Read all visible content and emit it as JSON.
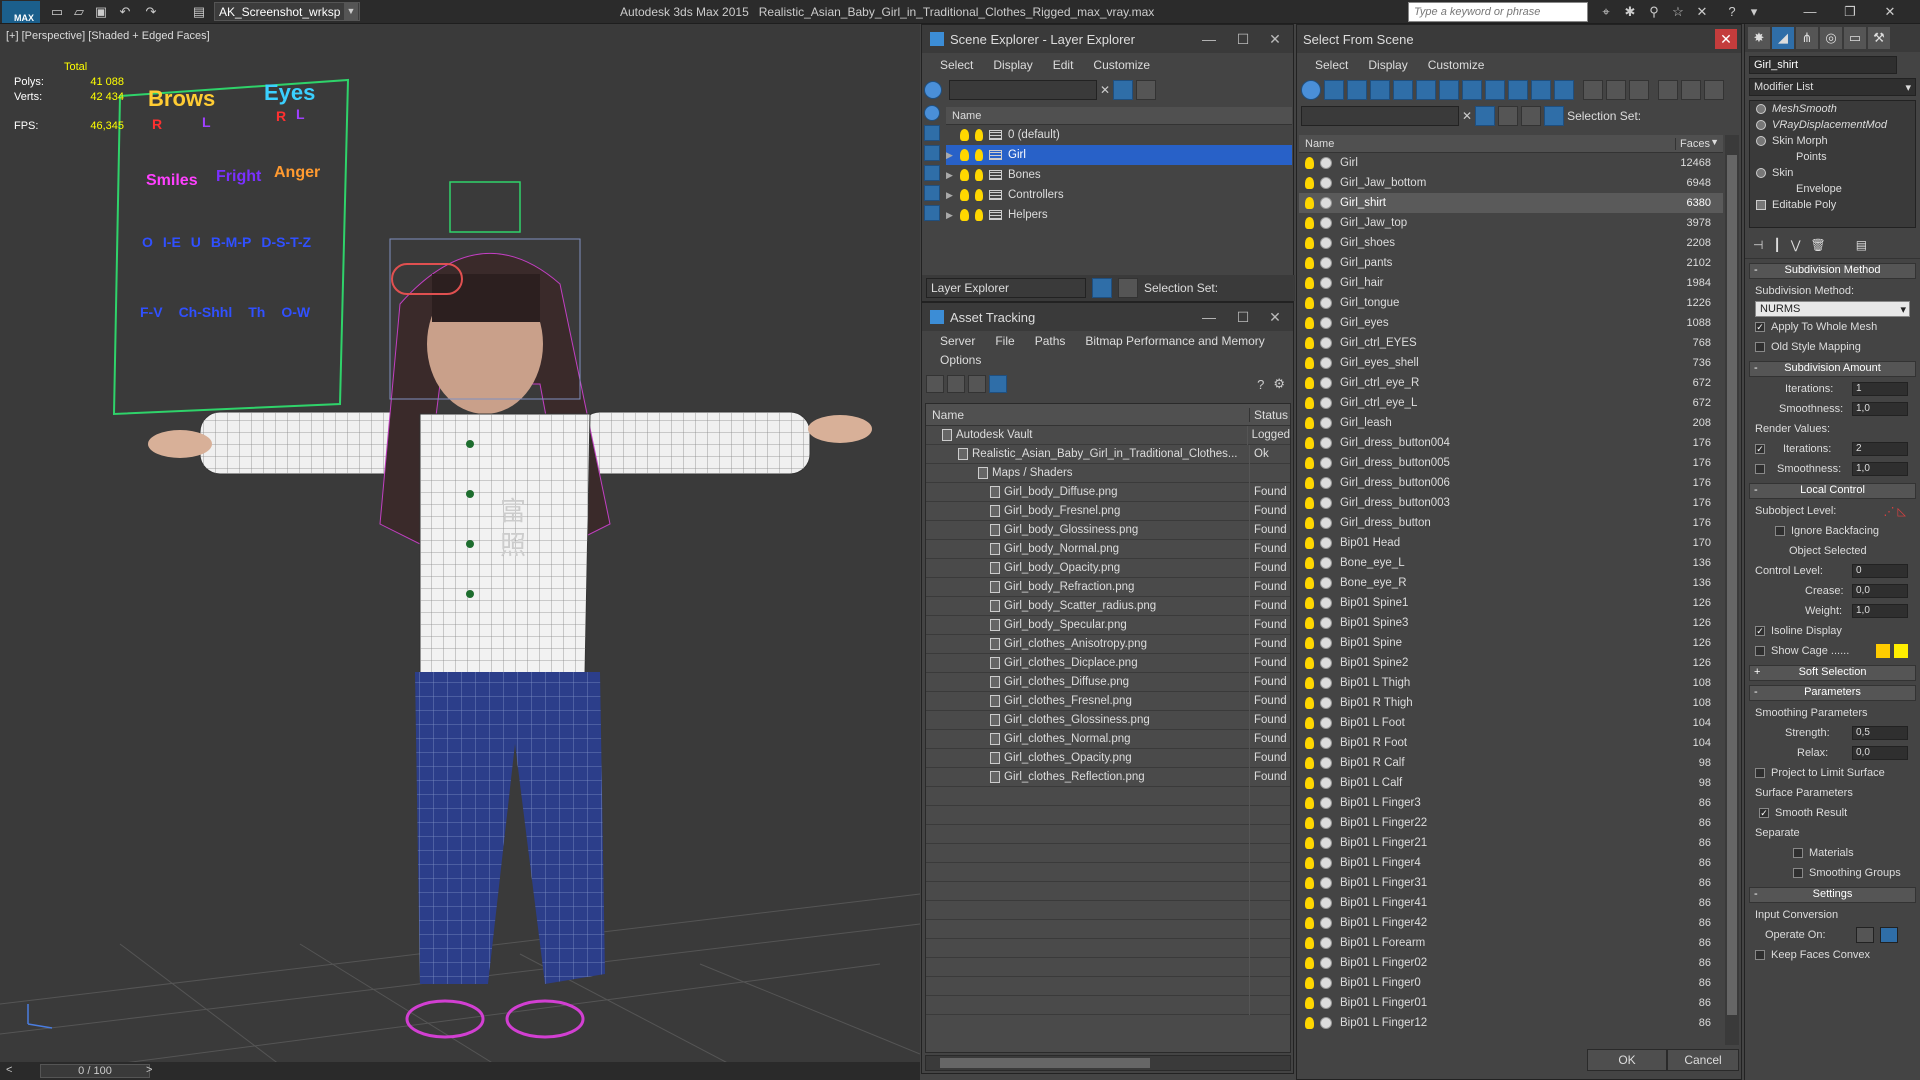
{
  "titlebar": {
    "workspace": "AK_Screenshot_wrksp",
    "app": "Autodesk 3ds Max  2015",
    "file": "Realistic_Asian_Baby_Girl_in_Traditional_Clothes_Rigged_max_vray.max",
    "keyword_placeholder": "Type a keyword or phrase",
    "logo": "MAX"
  },
  "viewport": {
    "label": "[+] [Perspective] [Shaded + Edged Faces]",
    "total_label": "Total",
    "polys_label": "Polys:",
    "polys": "41 088",
    "verts_label": "Verts:",
    "verts": "42 434",
    "fps_label": "FPS:",
    "fps": "46,345",
    "frame": "0 / 100",
    "panel": {
      "brows": "Brows",
      "eyes": "Eyes",
      "r": "R",
      "l": "L",
      "smiles": "Smiles",
      "fright": "Fright",
      "anger": "Anger",
      "row3": [
        "O",
        "I-E",
        "U",
        "B-M-P",
        "D-S-T-Z"
      ],
      "row4": [
        "F-V",
        "Ch-Shhl",
        "Th",
        "O-W"
      ]
    },
    "shirt_chars": [
      "富",
      "照"
    ]
  },
  "scene_explorer": {
    "title": "Scene Explorer - Layer Explorer",
    "menu": [
      "Select",
      "Display",
      "Edit",
      "Customize"
    ],
    "column": "Name",
    "layers": [
      {
        "name": "0 (default)",
        "sel": false,
        "exp": false
      },
      {
        "name": "Girl",
        "sel": true,
        "exp": true
      },
      {
        "name": "Bones",
        "sel": false,
        "exp": true
      },
      {
        "name": "Controllers",
        "sel": false,
        "exp": true
      },
      {
        "name": "Helpers",
        "sel": false,
        "exp": true
      }
    ],
    "footer_label": "Layer Explorer",
    "selection_set": "Selection Set:"
  },
  "asset_tracking": {
    "title": "Asset Tracking",
    "menu": [
      "Server",
      "File",
      "Paths",
      "Bitmap Performance and Memory"
    ],
    "menu2": "Options",
    "col_name": "Name",
    "col_status": "Status",
    "rows": [
      {
        "name": "Autodesk Vault",
        "status": "Logged",
        "indent": 1
      },
      {
        "name": "Realistic_Asian_Baby_Girl_in_Traditional_Clothes...",
        "status": "Ok",
        "indent": 2
      },
      {
        "name": "Maps / Shaders",
        "status": "",
        "indent": 3
      },
      {
        "name": "Girl_body_Diffuse.png",
        "status": "Found",
        "indent": 4
      },
      {
        "name": "Girl_body_Fresnel.png",
        "status": "Found",
        "indent": 4
      },
      {
        "name": "Girl_body_Glossiness.png",
        "status": "Found",
        "indent": 4
      },
      {
        "name": "Girl_body_Normal.png",
        "status": "Found",
        "indent": 4
      },
      {
        "name": "Girl_body_Opacity.png",
        "status": "Found",
        "indent": 4
      },
      {
        "name": "Girl_body_Refraction.png",
        "status": "Found",
        "indent": 4
      },
      {
        "name": "Girl_body_Scatter_radius.png",
        "status": "Found",
        "indent": 4
      },
      {
        "name": "Girl_body_Specular.png",
        "status": "Found",
        "indent": 4
      },
      {
        "name": "Girl_clothes_Anisotropy.png",
        "status": "Found",
        "indent": 4
      },
      {
        "name": "Girl_clothes_Dicplace.png",
        "status": "Found",
        "indent": 4
      },
      {
        "name": "Girl_clothes_Diffuse.png",
        "status": "Found",
        "indent": 4
      },
      {
        "name": "Girl_clothes_Fresnel.png",
        "status": "Found",
        "indent": 4
      },
      {
        "name": "Girl_clothes_Glossiness.png",
        "status": "Found",
        "indent": 4
      },
      {
        "name": "Girl_clothes_Normal.png",
        "status": "Found",
        "indent": 4
      },
      {
        "name": "Girl_clothes_Opacity.png",
        "status": "Found",
        "indent": 4
      },
      {
        "name": "Girl_clothes_Reflection.png",
        "status": "Found",
        "indent": 4
      }
    ]
  },
  "select_from_scene": {
    "title": "Select From Scene",
    "menu": [
      "Select",
      "Display",
      "Customize"
    ],
    "selection_set": "Selection Set:",
    "col_name": "Name",
    "col_faces": "Faces",
    "rows": [
      [
        "Girl",
        "12468",
        0
      ],
      [
        "Girl_Jaw_bottom",
        "6948",
        0
      ],
      [
        "Girl_shirt",
        "6380",
        1
      ],
      [
        "Girl_Jaw_top",
        "3978",
        0
      ],
      [
        "Girl_shoes",
        "2208",
        0
      ],
      [
        "Girl_pants",
        "2102",
        0
      ],
      [
        "Girl_hair",
        "1984",
        0
      ],
      [
        "Girl_tongue",
        "1226",
        0
      ],
      [
        "Girl_eyes",
        "1088",
        0
      ],
      [
        "Girl_ctrl_EYES",
        "768",
        0
      ],
      [
        "Girl_eyes_shell",
        "736",
        0
      ],
      [
        "Girl_ctrl_eye_R",
        "672",
        0
      ],
      [
        "Girl_ctrl_eye_L",
        "672",
        0
      ],
      [
        "Girl_leash",
        "208",
        0
      ],
      [
        "Girl_dress_button004",
        "176",
        0
      ],
      [
        "Girl_dress_button005",
        "176",
        0
      ],
      [
        "Girl_dress_button006",
        "176",
        0
      ],
      [
        "Girl_dress_button003",
        "176",
        0
      ],
      [
        "Girl_dress_button",
        "176",
        0
      ],
      [
        "Bip01 Head",
        "170",
        0
      ],
      [
        "Bone_eye_L",
        "136",
        0
      ],
      [
        "Bone_eye_R",
        "136",
        0
      ],
      [
        "Bip01 Spine1",
        "126",
        0
      ],
      [
        "Bip01 Spine3",
        "126",
        0
      ],
      [
        "Bip01 Spine",
        "126",
        0
      ],
      [
        "Bip01 Spine2",
        "126",
        0
      ],
      [
        "Bip01 L Thigh",
        "108",
        0
      ],
      [
        "Bip01 R Thigh",
        "108",
        0
      ],
      [
        "Bip01 L Foot",
        "104",
        0
      ],
      [
        "Bip01 R Foot",
        "104",
        0
      ],
      [
        "Bip01 R Calf",
        "98",
        0
      ],
      [
        "Bip01 L Calf",
        "98",
        0
      ],
      [
        "Bip01 L Finger3",
        "86",
        0
      ],
      [
        "Bip01 L Finger22",
        "86",
        0
      ],
      [
        "Bip01 L Finger21",
        "86",
        0
      ],
      [
        "Bip01 L Finger4",
        "86",
        0
      ],
      [
        "Bip01 L Finger31",
        "86",
        0
      ],
      [
        "Bip01 L Finger41",
        "86",
        0
      ],
      [
        "Bip01 L Finger42",
        "86",
        0
      ],
      [
        "Bip01 L Forearm",
        "86",
        0
      ],
      [
        "Bip01 L Finger02",
        "86",
        0
      ],
      [
        "Bip01 L Finger0",
        "86",
        0
      ],
      [
        "Bip01 L Finger01",
        "86",
        0
      ],
      [
        "Bip01 L Finger12",
        "86",
        0
      ]
    ],
    "ok": "OK",
    "cancel": "Cancel"
  },
  "command_panel": {
    "object_name": "Girl_shirt",
    "modifier_list": "Modifier List",
    "stack": [
      "MeshSmooth",
      "VRayDisplacementMod",
      "Skin Morph",
      "Points",
      "Skin",
      "Envelope",
      "Editable Poly"
    ],
    "subdivision_method": "Subdivision Method",
    "subdivision_method_label": "Subdivision Method:",
    "method": "NURMS",
    "apply_whole": "Apply To Whole Mesh",
    "old_style": "Old Style Mapping",
    "subdivision_amount": "Subdivision Amount",
    "iterations_label": "Iterations:",
    "iterations": "1",
    "smoothness_label": "Smoothness:",
    "smoothness": "1,0",
    "render_values": "Render Values:",
    "r_iterations": "2",
    "r_smoothness": "1,0",
    "local_control": "Local Control",
    "subobject_level": "Subobject Level:",
    "ignore_backfacing": "Ignore Backfacing",
    "object_selected": "Object Selected",
    "control_level": "Control Level:",
    "control_level_val": "0",
    "crease": "Crease:",
    "crease_val": "0,0",
    "weight": "Weight:",
    "weight_val": "1,0",
    "isoline": "Isoline Display",
    "show_cage": "Show Cage ......",
    "soft_selection": "Soft Selection",
    "parameters": "Parameters",
    "smoothing_params": "Smoothing Parameters",
    "strength": "Strength:",
    "strength_val": "0,5",
    "relax": "Relax:",
    "relax_val": "0,0",
    "project": "Project to Limit Surface",
    "surface_params": "Surface Parameters",
    "smooth_result": "Smooth Result",
    "separate": "Separate",
    "materials": "Materials",
    "smoothing_groups": "Smoothing Groups",
    "settings": "Settings",
    "input_conversion": "Input Conversion",
    "operate_on": "Operate On:",
    "keep_faces": "Keep Faces Convex",
    "cage_colors": [
      "#ffcc00",
      "#ffee00"
    ]
  }
}
